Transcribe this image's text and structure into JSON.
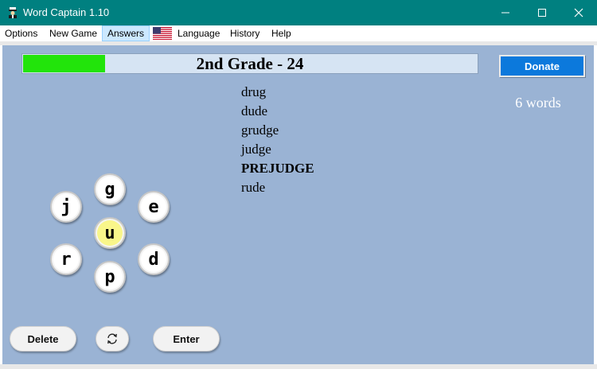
{
  "window": {
    "title": "Word Captain 1.10"
  },
  "menu": {
    "options": "Options",
    "new_game": "New Game",
    "answers": "Answers",
    "language": "Language",
    "history": "History",
    "help": "Help"
  },
  "game": {
    "level_label": "2nd Grade - 24",
    "progress": 0.18,
    "word_count_label": "6 words",
    "found_words": [
      "drug",
      "dude",
      "grudge",
      "judge",
      "PREJUDGE",
      "rude"
    ],
    "letters": {
      "top": "g",
      "upper_left": "j",
      "upper_right": "e",
      "center": "u",
      "lower_left": "r",
      "lower_right": "d",
      "bottom": "p"
    }
  },
  "buttons": {
    "donate": "Donate",
    "delete": "Delete",
    "enter": "Enter",
    "shuffle_icon": "refresh-icon"
  },
  "colors": {
    "titlebar": "#008080",
    "board": "#9ab3d4",
    "progress_fill": "#22e40b",
    "donate": "#0c79dc",
    "center_tile": "#f9f68a"
  }
}
